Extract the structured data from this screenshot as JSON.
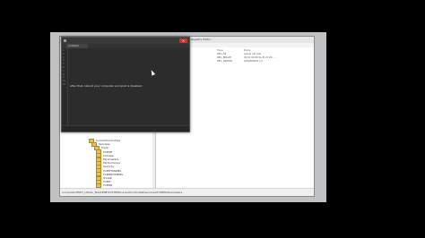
{
  "regedit": {
    "title": "Registry Editor",
    "columns": [
      "Type",
      "Data"
    ],
    "values": [
      {
        "type": "REG_SZ",
        "data": "(value not set)"
      },
      {
        "type": "REG_BINARY",
        "data": "00 01 00 00 5a f0 21 00 ..."
      },
      {
        "type": "REG_DWORD",
        "data": "0x00000001 (1)"
      }
    ],
    "tree": [
      "CurrentControlSet",
      "Services",
      "Tcpip",
      "TCPIP6",
      "Linkage",
      "Parameters",
      "Performance",
      "Security",
      "TCPIPTUNNEL",
      "TCPIP6TUNNEL",
      "Tcpip6",
      "TCPIP",
      "TCPIP6",
      "TDPIPE",
      "TDTCP",
      "Themes",
      "TimeBroker",
      "TPM",
      "TrkWks",
      "TrustedInstaller",
      "TSDDD",
      "TsUsbFlt",
      "TsUsbGD",
      "TSWK"
    ],
    "status": "Computer\\HKEY_LOCAL_MACHINE\\SYSTEM\\CurrentControlSet\\services\\TCPIP6\\Parameters"
  },
  "editor": {
    "tab": "untitled",
    "line_numbers": [
      "1",
      "2",
      "3",
      "4",
      "5",
      "6",
      "7",
      "8",
      "9",
      "10",
      "11"
    ],
    "text": "After that, reboot your computer and ipv6 is disabled.",
    "close_glyph": "×"
  }
}
